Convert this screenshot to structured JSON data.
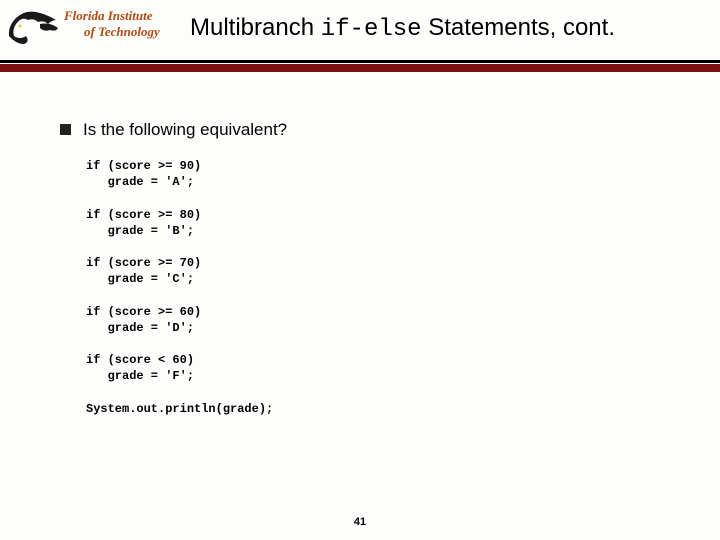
{
  "logo": {
    "line1": "Florida Institute",
    "line2": "of Technology"
  },
  "title": {
    "before_mono": "Multibranch ",
    "mono": "if-else",
    "after_mono": " Statements, cont."
  },
  "bullet": {
    "text": "Is the following equivalent?"
  },
  "code": {
    "block1_l1": "if (score >= 90)",
    "block1_l2": "   grade = 'A';",
    "block2_l1": "if (score >= 80)",
    "block2_l2": "   grade = 'B';",
    "block3_l1": "if (score >= 70)",
    "block3_l2": "   grade = 'C';",
    "block4_l1": "if (score >= 60)",
    "block4_l2": "   grade = 'D';",
    "block5_l1": "if (score < 60)",
    "block5_l2": "   grade = 'F';",
    "println": "System.out.println(grade);"
  },
  "page_number": "41"
}
